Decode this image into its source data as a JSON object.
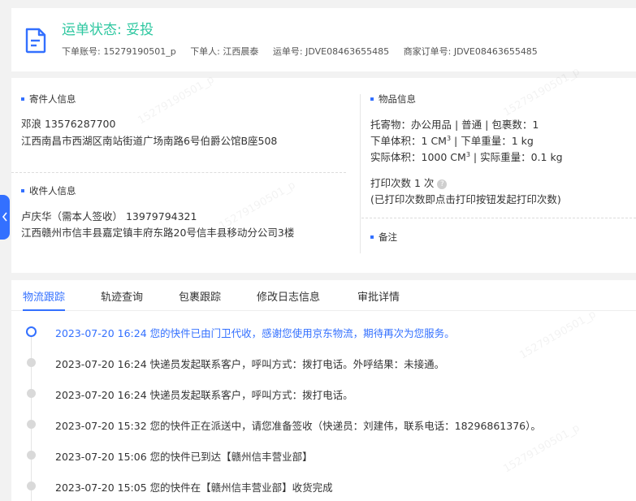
{
  "header": {
    "status_title": "运单状态: 妥投",
    "account_label": "下单账号:",
    "account_value": "15279190501_p",
    "placer_label": "下单人:",
    "placer_value": "江西晨泰",
    "waybill_label": "运单号:",
    "waybill_value": "JDVE08463655485",
    "merchant_order_label": "商家订单号:",
    "merchant_order_value": "JDVE08463655485"
  },
  "sender": {
    "title": "寄件人信息",
    "name_phone": "邓浪   13576287700",
    "address": "江西南昌市西湖区南站街道广场南路6号伯爵公馆B座508"
  },
  "receiver": {
    "title": "收件人信息",
    "name_phone": "卢庆华（需本人签收）   13979794321",
    "address": "江西赣州市信丰县嘉定镇丰府东路20号信丰县移动分公司3楼"
  },
  "goods": {
    "title": "物品信息",
    "consign": "托寄物：办公用品 | 普通 | 包裹数：1",
    "order_volume_label": "下单体积：",
    "order_volume_value": "1 CM",
    "order_weight": "下单重量：1 kg",
    "actual_volume_label": "实际体积：",
    "actual_volume_value": "1000 CM",
    "volume_sup": "3",
    "actual_weight": "实际重量：0.1 kg",
    "print_count": "打印次数   1 次",
    "help_icon": "question-circle-icon",
    "print_note": "(已打印次数即点击打印按钮发起打印次数)"
  },
  "remark": {
    "title": "备注"
  },
  "tabs": [
    {
      "label": "物流跟踪",
      "active": true
    },
    {
      "label": "轨迹查询"
    },
    {
      "label": "包裹跟踪"
    },
    {
      "label": "修改日志信息"
    },
    {
      "label": "审批详情"
    }
  ],
  "timeline": [
    {
      "time": "2023-07-20 16:24",
      "text": "您的快件已由门卫代收，感谢您使用京东物流，期待再次为您服务。",
      "current": true
    },
    {
      "time": "2023-07-20 16:24",
      "text": "快递员发起联系客户，呼叫方式：拨打电话。外呼结果：未接通。"
    },
    {
      "time": "2023-07-20 16:24",
      "text": "快递员发起联系客户，呼叫方式：拨打电话。"
    },
    {
      "time": "2023-07-20 15:32",
      "text": "您的快件正在派送中，请您准备签收（快递员：刘建伟，联系电话：18296861376）。"
    },
    {
      "time": "2023-07-20 15:06",
      "text": "您的快件已到达【赣州信丰营业部】"
    },
    {
      "time": "2023-07-20 15:05",
      "text": "您的快件在【赣州信丰营业部】收货完成"
    }
  ],
  "watermark": "15279190501_p",
  "colors": {
    "accent": "#3370ff",
    "status": "#2ec7a0"
  }
}
